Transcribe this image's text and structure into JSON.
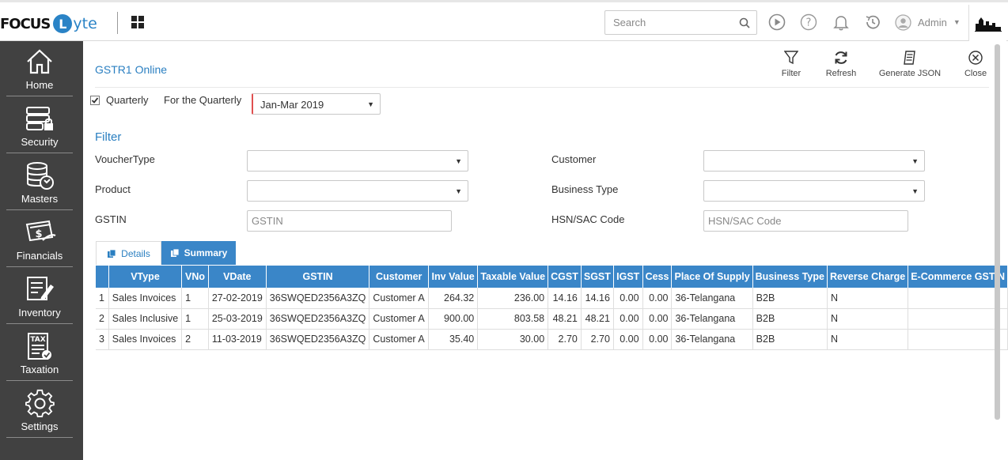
{
  "header": {
    "logo_focus": "FOCUS",
    "logo_l": "L",
    "logo_yte": "yte",
    "search_placeholder": "Search",
    "user_name": "Admin"
  },
  "sidebar": {
    "items": [
      {
        "label": "Home",
        "icon": "home-icon"
      },
      {
        "label": "Security",
        "icon": "security-icon"
      },
      {
        "label": "Masters",
        "icon": "masters-icon"
      },
      {
        "label": "Financials",
        "icon": "financials-icon"
      },
      {
        "label": "Inventory",
        "icon": "inventory-icon"
      },
      {
        "label": "Taxation",
        "icon": "taxation-icon"
      },
      {
        "label": "Settings",
        "icon": "settings-icon"
      }
    ]
  },
  "page": {
    "title": "GSTR1 Online",
    "toolbar": {
      "filter": "Filter",
      "refresh": "Refresh",
      "generate_json": "Generate JSON",
      "close": "Close"
    },
    "quarterly_label": "Quarterly",
    "quarterly_checked": true,
    "for_quarter_label": "For the Quarterly",
    "quarter_value": "Jan-Mar 2019",
    "filter_heading": "Filter",
    "filters": {
      "voucher_type_label": "VoucherType",
      "voucher_type_value": "",
      "customer_label": "Customer",
      "customer_value": "",
      "product_label": "Product",
      "product_value": "",
      "business_type_label": "Business Type",
      "business_type_value": "",
      "gstin_label": "GSTIN",
      "gstin_placeholder": "GSTIN",
      "hsn_label": "HSN/SAC Code",
      "hsn_placeholder": "HSN/SAC Code"
    },
    "tabs": {
      "details": "Details",
      "summary": "Summary"
    }
  },
  "table": {
    "columns": [
      "",
      "VType",
      "VNo",
      "VDate",
      "GSTIN",
      "Customer",
      "Inv Value",
      "Taxable Value",
      "CGST",
      "SGST",
      "IGST",
      "Cess",
      "Place Of Supply",
      "Business Type",
      "Reverse Charge",
      "E-Commerce GSTIN"
    ],
    "rows": [
      [
        "1",
        "Sales Invoices",
        "1",
        "27-02-2019",
        "36SWQED2356A3ZQ",
        "Customer A",
        "264.32",
        "236.00",
        "14.16",
        "14.16",
        "0.00",
        "0.00",
        "36-Telangana",
        "B2B",
        "N",
        ""
      ],
      [
        "2",
        "Sales Inclusive",
        "1",
        "25-03-2019",
        "36SWQED2356A3ZQ",
        "Customer A",
        "900.00",
        "803.58",
        "48.21",
        "48.21",
        "0.00",
        "0.00",
        "36-Telangana",
        "B2B",
        "N",
        ""
      ],
      [
        "3",
        "Sales Invoices",
        "2",
        "11-03-2019",
        "36SWQED2356A3ZQ",
        "Customer A",
        "35.40",
        "30.00",
        "2.70",
        "2.70",
        "0.00",
        "0.00",
        "36-Telangana",
        "B2B",
        "N",
        ""
      ]
    ]
  },
  "colors": {
    "accent": "#3a86c8",
    "sidebar": "#414141",
    "title": "#2a7fc1"
  }
}
